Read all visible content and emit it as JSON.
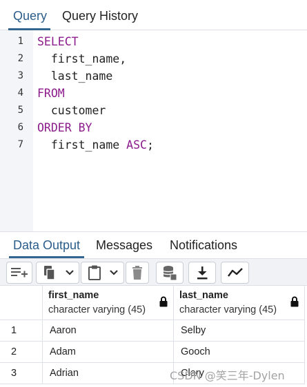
{
  "editor_tabs": [
    {
      "label": "Query",
      "active": true
    },
    {
      "label": "Query History",
      "active": false
    }
  ],
  "editor": {
    "lines": [
      {
        "num": "1",
        "tokens": [
          {
            "t": "SELECT",
            "kw": true
          }
        ]
      },
      {
        "num": "2",
        "tokens": [
          {
            "t": "  first_name,",
            "kw": false
          }
        ]
      },
      {
        "num": "3",
        "tokens": [
          {
            "t": "  last_name",
            "kw": false
          }
        ]
      },
      {
        "num": "4",
        "tokens": [
          {
            "t": "FROM",
            "kw": true
          }
        ]
      },
      {
        "num": "5",
        "tokens": [
          {
            "t": "  customer",
            "kw": false
          }
        ]
      },
      {
        "num": "6",
        "tokens": [
          {
            "t": "ORDER BY",
            "kw": true
          }
        ]
      },
      {
        "num": "7",
        "tokens": [
          {
            "t": "  first_name ",
            "kw": false
          },
          {
            "t": "ASC",
            "kw": true
          },
          {
            "t": ";",
            "kw": false
          }
        ]
      }
    ]
  },
  "output_tabs": [
    {
      "label": "Data Output",
      "active": true
    },
    {
      "label": "Messages",
      "active": false
    },
    {
      "label": "Notifications",
      "active": false
    }
  ],
  "toolbar": {
    "buttons": [
      "add-row-icon",
      "copy-icon",
      "chevron-down-icon",
      "paste-icon",
      "chevron-down-icon",
      "delete-icon",
      "save-data-icon",
      "download-icon",
      "graph-visualiser-icon"
    ]
  },
  "grid": {
    "columns": [
      {
        "name": "first_name",
        "type": "character varying (45)",
        "locked": true
      },
      {
        "name": "last_name",
        "type": "character varying (45)",
        "locked": true
      }
    ],
    "rows": [
      {
        "num": "1",
        "first_name": "Aaron",
        "last_name": "Selby"
      },
      {
        "num": "2",
        "first_name": "Adam",
        "last_name": "Gooch"
      },
      {
        "num": "3",
        "first_name": "Adrian",
        "last_name": "Clary"
      }
    ]
  },
  "watermark": "CSDN @笑三年-Dylen",
  "colors": {
    "keyword": "#8c1b8c",
    "active_tab": "#2a5d8a",
    "gutter": "#f3f5f8",
    "toolbar": "#f0f2f5"
  }
}
